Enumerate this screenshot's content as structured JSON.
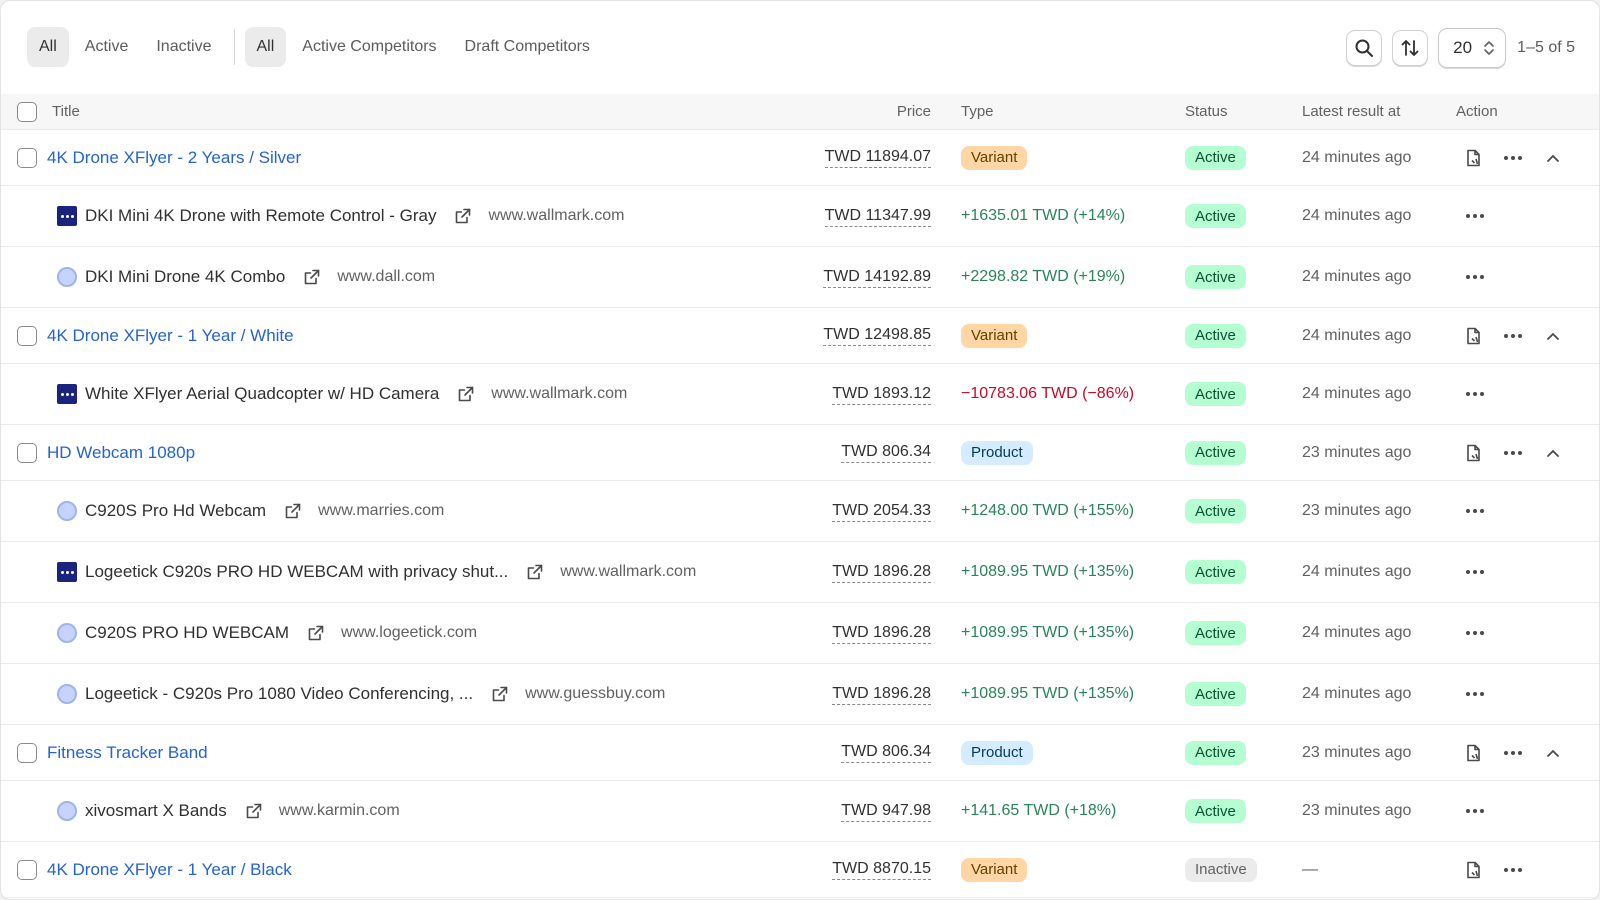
{
  "toolbar": {
    "status_tabs": [
      "All",
      "Active",
      "Inactive"
    ],
    "type_tabs": [
      "All",
      "Active Competitors",
      "Draft Competitors"
    ],
    "per_page": "20",
    "count": "1–5 of 5"
  },
  "columns": {
    "title": "Title",
    "price": "Price",
    "type": "Type",
    "status": "Status",
    "latest": "Latest result at",
    "action": "Action"
  },
  "rows": [
    {
      "kind": "product",
      "title": "4K Drone XFlyer - 2 Years / Silver",
      "price": "TWD 11894.07",
      "type": "Variant",
      "status": "Active",
      "latest": "24 minutes ago"
    },
    {
      "kind": "competitor",
      "favicon": "wallmark-favicon",
      "title": "DKI Mini 4K Drone with Remote Control - Gray",
      "domain": "www.wallmark.com",
      "price": "TWD 11347.99",
      "diff": "+1635.01 TWD (+14%)",
      "diff_sign": "pos",
      "status": "Active",
      "latest": "24 minutes ago"
    },
    {
      "kind": "competitor",
      "favicon": "globe-favicon",
      "title": "DKI Mini Drone 4K Combo",
      "domain": "www.dall.com",
      "price": "TWD 14192.89",
      "diff": "+2298.82 TWD (+19%)",
      "diff_sign": "pos",
      "status": "Active",
      "latest": "24 minutes ago"
    },
    {
      "kind": "product",
      "title": "4K Drone XFlyer - 1 Year / White",
      "price": "TWD 12498.85",
      "type": "Variant",
      "status": "Active",
      "latest": "24 minutes ago"
    },
    {
      "kind": "competitor",
      "favicon": "wallmark-favicon",
      "title": "White XFlyer Aerial Quadcopter w/ HD Camera",
      "domain": "www.wallmark.com",
      "price": "TWD 1893.12",
      "diff": "−10783.06 TWD (−86%)",
      "diff_sign": "neg",
      "status": "Active",
      "latest": "24 minutes ago"
    },
    {
      "kind": "product",
      "title": "HD Webcam 1080p",
      "price": "TWD 806.34",
      "type": "Product",
      "status": "Active",
      "latest": "23 minutes ago"
    },
    {
      "kind": "competitor",
      "favicon": "globe-favicon",
      "title": "C920S Pro Hd Webcam",
      "domain": "www.marries.com",
      "price": "TWD 2054.33",
      "diff": "+1248.00 TWD (+155%)",
      "diff_sign": "pos",
      "status": "Active",
      "latest": "23 minutes ago"
    },
    {
      "kind": "competitor",
      "favicon": "wallmark-favicon",
      "title": "Logeetick C920s PRO HD WEBCAM with privacy shut...",
      "domain": "www.wallmark.com",
      "price": "TWD 1896.28",
      "diff": "+1089.95 TWD (+135%)",
      "diff_sign": "pos",
      "status": "Active",
      "latest": "24 minutes ago"
    },
    {
      "kind": "competitor",
      "favicon": "globe-favicon",
      "title": "C920S PRO HD WEBCAM",
      "domain": "www.logeetick.com",
      "price": "TWD 1896.28",
      "diff": "+1089.95 TWD (+135%)",
      "diff_sign": "pos",
      "status": "Active",
      "latest": "24 minutes ago"
    },
    {
      "kind": "competitor",
      "favicon": "globe-favicon",
      "title": "Logeetick - C920s Pro 1080 Video Conferencing, ...",
      "domain": "www.guessbuy.com",
      "price": "TWD 1896.28",
      "diff": "+1089.95 TWD (+135%)",
      "diff_sign": "pos",
      "status": "Active",
      "latest": "24 minutes ago"
    },
    {
      "kind": "product",
      "title": "Fitness Tracker Band",
      "price": "TWD 806.34",
      "type": "Product",
      "status": "Active",
      "latest": "23 minutes ago"
    },
    {
      "kind": "competitor",
      "favicon": "globe-favicon",
      "title": "xivosmart X Bands",
      "domain": "www.karmin.com",
      "price": "TWD 947.98",
      "diff": "+141.65 TWD (+18%)",
      "diff_sign": "pos",
      "status": "Active",
      "latest": "23 minutes ago"
    },
    {
      "kind": "product",
      "title": "4K Drone XFlyer - 1 Year / Black",
      "price": "TWD 8870.15",
      "type": "Variant",
      "status": "Inactive",
      "latest": "—",
      "collapsed": true
    }
  ]
}
